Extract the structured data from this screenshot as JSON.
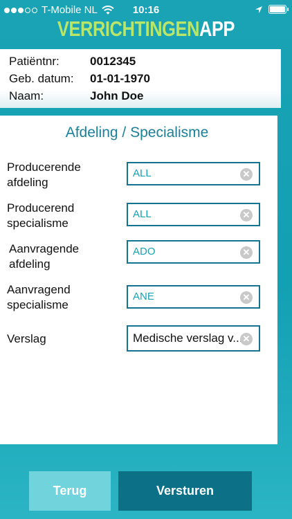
{
  "status_bar": {
    "carrier": "T-Mobile NL",
    "time": "10:16"
  },
  "app_logo": {
    "part1": "VERRICHTINGEN",
    "part2": "APP"
  },
  "patient": {
    "id_label": "Patiëntnr:",
    "id_value": "0012345",
    "dob_label": "Geb. datum:",
    "dob_value": "01-01-1970",
    "name_label": "Naam:",
    "name_value": "John Doe"
  },
  "section": {
    "title": "Afdeling / Specialisme"
  },
  "fields": {
    "producing_department": {
      "label_line1": "Producerende",
      "label_line2": "afdeling",
      "value": "ALL"
    },
    "producing_specialism": {
      "label_line1": "Producerend",
      "label_line2": "specialisme",
      "value": "ALL"
    },
    "requesting_department": {
      "label_line1": "Aanvragende",
      "label_line2": "afdeling",
      "value": "ADO"
    },
    "requesting_specialism": {
      "label_line1": "Aanvragend",
      "label_line2": "specialisme",
      "value": "ANE"
    },
    "report": {
      "label": "Verslag",
      "value": "Medische verslag v..."
    }
  },
  "icons": {
    "clear": "clear-icon"
  },
  "buttons": {
    "back": "Terug",
    "send": "Versturen"
  },
  "colors": {
    "brand_teal": "#12a0b3",
    "logo_green": "#b7e66a",
    "title_blue": "#1b7f97",
    "input_border": "#127490",
    "back_button": "#71d3dc",
    "send_button": "#0c7087"
  }
}
